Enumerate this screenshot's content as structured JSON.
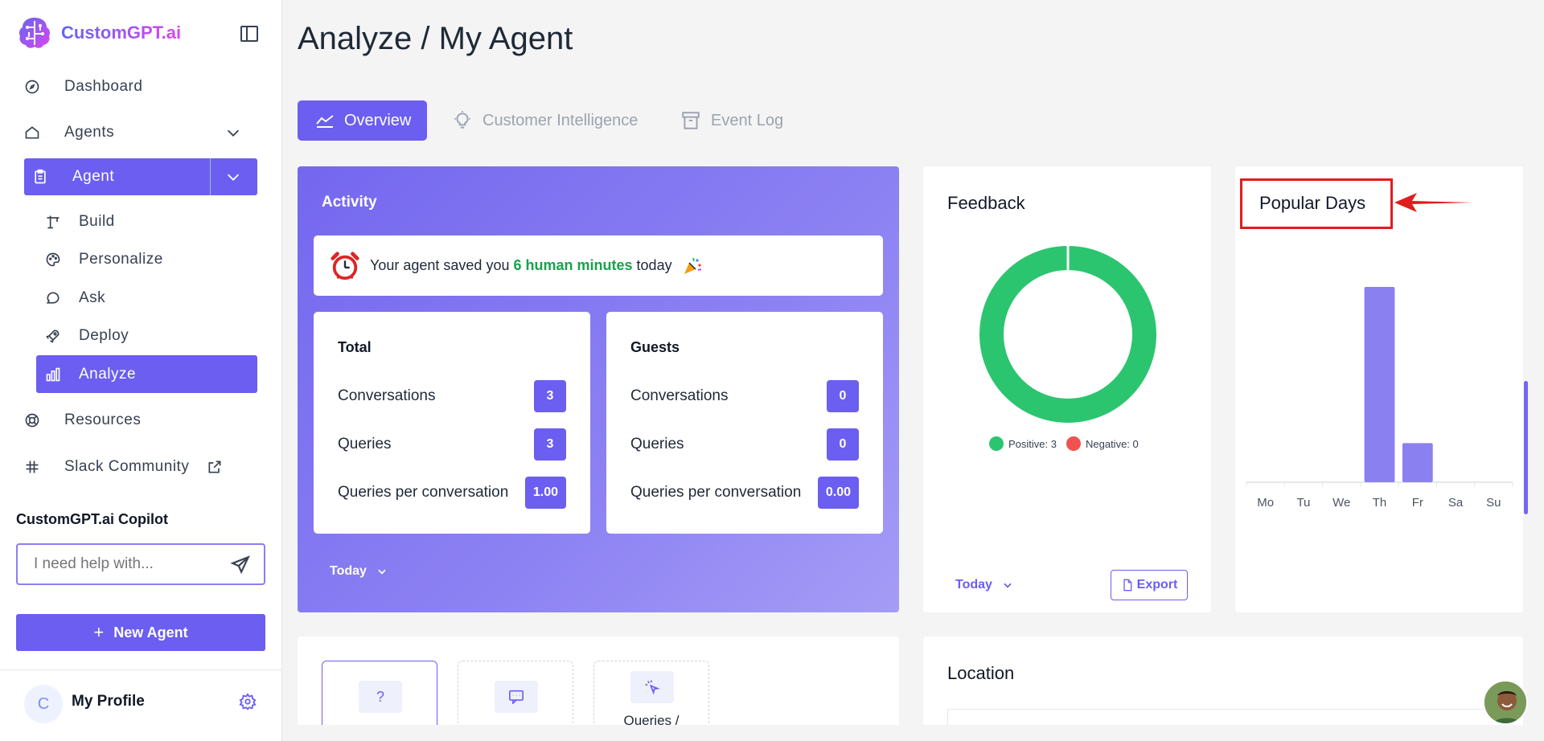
{
  "brand": {
    "name": "CustomGPT.ai"
  },
  "sidebar": {
    "items": [
      {
        "label": "Dashboard"
      },
      {
        "label": "Agents"
      },
      {
        "label": "Agent"
      },
      {
        "label": "Build"
      },
      {
        "label": "Personalize"
      },
      {
        "label": "Ask"
      },
      {
        "label": "Deploy"
      },
      {
        "label": "Analyze"
      },
      {
        "label": "Resources"
      },
      {
        "label": "Slack Community"
      }
    ],
    "copilot_title": "CustomGPT.ai Copilot",
    "copilot_placeholder": "I need help with...",
    "new_agent_label": "New Agent",
    "profile_initial": "C",
    "profile_name": "My Profile"
  },
  "page": {
    "title": "Analyze / My Agent"
  },
  "tabs": [
    {
      "label": "Overview",
      "active": true
    },
    {
      "label": "Customer Intelligence",
      "active": false
    },
    {
      "label": "Event Log",
      "active": false
    }
  ],
  "activity": {
    "title": "Activity",
    "saved_prefix": "Your agent saved you",
    "saved_highlight": "6 human minutes",
    "saved_suffix": "today",
    "total": {
      "title": "Total",
      "rows": [
        {
          "label": "Conversations",
          "value": "3"
        },
        {
          "label": "Queries",
          "value": "3"
        },
        {
          "label": "Queries per conversation",
          "value": "1.00"
        }
      ]
    },
    "guests": {
      "title": "Guests",
      "rows": [
        {
          "label": "Conversations",
          "value": "0"
        },
        {
          "label": "Queries",
          "value": "0"
        },
        {
          "label": "Queries per conversation",
          "value": "0.00"
        }
      ]
    },
    "range_label": "Today"
  },
  "feedback": {
    "title": "Feedback",
    "positive_label": "Positive: 3",
    "negative_label": "Negative: 0",
    "range_label": "Today",
    "export_label": "Export",
    "colors": {
      "positive": "#2cc56f",
      "negative": "#ef5350"
    }
  },
  "chart_data": [
    {
      "type": "pie",
      "title": "Feedback",
      "categories": [
        "Positive",
        "Negative"
      ],
      "values": [
        3,
        0
      ]
    },
    {
      "type": "bar",
      "title": "Popular Days",
      "categories": [
        "Mo",
        "Tu",
        "We",
        "Th",
        "Fr",
        "Sa",
        "Su"
      ],
      "values": [
        0,
        0,
        0,
        5,
        1,
        0,
        0
      ],
      "ylim": [
        0,
        5
      ],
      "xlabel": "",
      "ylabel": "",
      "grid": false,
      "color": "#8b80f0"
    }
  ],
  "popular": {
    "title": "Popular Days"
  },
  "bottom": {
    "tiles": [
      {
        "label": ""
      },
      {
        "label": ""
      },
      {
        "label": "Queries /"
      }
    ],
    "location_title": "Location"
  },
  "colors": {
    "accent": "#6b5ef0",
    "annotation": "#e11d1d",
    "success": "#16a34a"
  }
}
